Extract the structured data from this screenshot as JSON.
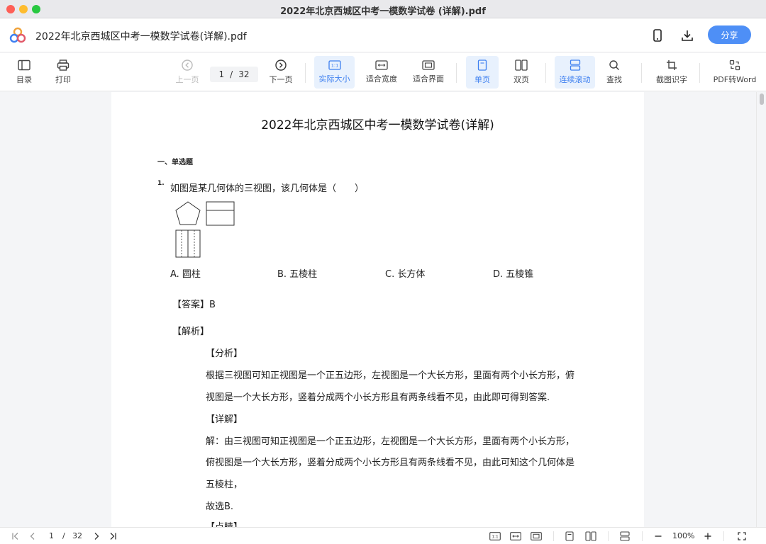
{
  "window": {
    "title": "2022年北京西城区中考一模数学试卷 (详解).pdf"
  },
  "header": {
    "doc_title": "2022年北京西城区中考一模数学试卷(详解).pdf",
    "share_label": "分享"
  },
  "toolbar": {
    "toc": "目录",
    "print": "打印",
    "prev": "上一页",
    "current_page": "1",
    "page_sep": "/",
    "total_pages": "32",
    "next": "下一页",
    "actual_size": "实际大小",
    "actual_size_icon_text": "1:1",
    "fit_width": "适合宽度",
    "fit_page": "适合界面",
    "single_page": "单页",
    "double_page": "双页",
    "continuous": "连续滚动",
    "search": "查找",
    "ocr": "截图识字",
    "pdf_to_word": "PDF转Word"
  },
  "document": {
    "title": "2022年北京西城区中考一模数学试卷(详解)",
    "section": "一、单选题",
    "question_number": "1.",
    "question": "如图是某几何体的三视图，该几何体是（　　）",
    "options": [
      "A. 圆柱",
      "B. 五棱柱",
      "C. 长方体",
      "D. 五棱锥"
    ],
    "answer": "【答案】B",
    "analysis_heading": "【解析】",
    "lines": [
      "【分析】",
      "根据三视图可知正视图是一个正五边形，左视图是一个大长方形，里面有两个小长方形，俯",
      "视图是一个大长方形，竖着分成两个小长方形且有两条线看不见，由此即可得到答案.",
      "【详解】",
      "解：由三视图可知正视图是一个正五边形，左视图是一个大长方形，里面有两个小长方形，",
      "俯视图是一个大长方形，竖着分成两个小长方形且有两条线看不见，由此可知这个几何体是",
      "五棱柱，",
      "故选B.",
      "【点睛】"
    ]
  },
  "bottombar": {
    "current_page": "1",
    "page_sep": "/",
    "total_pages": "32",
    "zoom": "100%",
    "actual_size_icon_text": "1:1"
  },
  "colors": {
    "accent": "#3d7ff0",
    "share": "#4e8ff6",
    "active_bg": "#e8f1fd"
  }
}
